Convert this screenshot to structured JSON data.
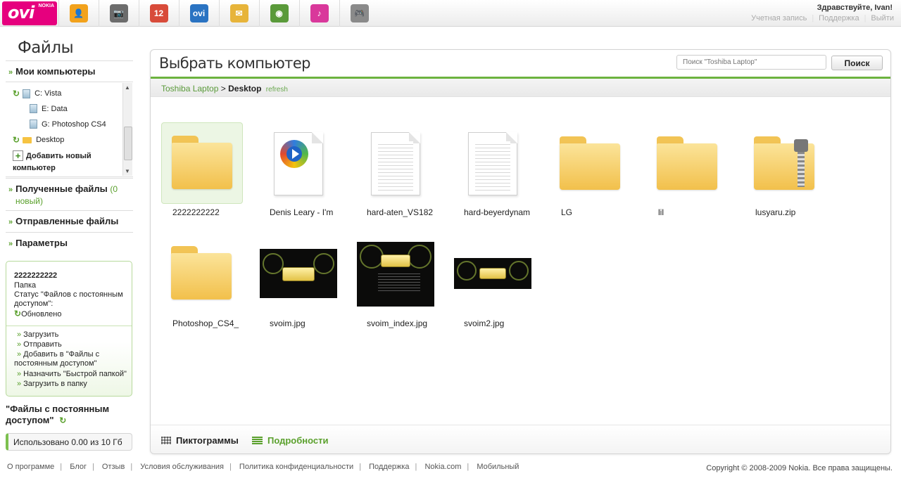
{
  "header": {
    "logo_text": "ovi",
    "logo_sub": "NOKIA",
    "apps": [
      {
        "name": "contacts-app-icon",
        "color": "#f2a21c",
        "glyph": "👤"
      },
      {
        "name": "photos-app-icon",
        "color": "#6c6c6c",
        "glyph": "📷"
      },
      {
        "name": "calendar-app-icon",
        "color": "#d84b3a",
        "glyph": "12"
      },
      {
        "name": "store-app-icon",
        "color": "#2a73c2",
        "glyph": "ovi"
      },
      {
        "name": "mail-app-icon",
        "color": "#e7b43a",
        "glyph": "✉"
      },
      {
        "name": "maps-app-icon",
        "color": "#5a9a3a",
        "glyph": "◉"
      },
      {
        "name": "music-app-icon",
        "color": "#d9389b",
        "glyph": "♪"
      },
      {
        "name": "games-app-icon",
        "color": "#8a8a8a",
        "glyph": "🎮"
      }
    ],
    "greeting": "Здравствуйте, Ivan!",
    "links": [
      "Учетная запись",
      "Поддержка",
      "Выйти"
    ]
  },
  "sidebar": {
    "title": "Файлы",
    "my_computers": "Мои компьютеры",
    "tree": [
      "C: Vista",
      "E: Data",
      "G: Photoshop CS4",
      "Desktop"
    ],
    "add_computer_1": "Добавить новый",
    "add_computer_2": "компьютер",
    "received": "Полученные файлы",
    "received_count": "(0",
    "received_count2": "новый)",
    "sent": "Отправленные файлы",
    "params": "Параметры",
    "info": {
      "name": "2222222222",
      "type": "Папка",
      "status_1": "Статус \"Файлов с постоянным",
      "status_2": "доступом\":",
      "status_value": "Обновлено",
      "actions": [
        "Загрузить",
        "Отправить",
        "Добавить в \"Файлы с",
        "постоянным доступом\"",
        "Назначить \"Быстрой папкой\"",
        "Загрузить в папку"
      ]
    },
    "shared_title_1": "\"Файлы с постоянным",
    "shared_title_2": "доступом\"",
    "usage": "Использовано 0.00 из 10 Гб"
  },
  "panel": {
    "title": "Выбрать компьютер",
    "search_placeholder": "Поиск \"Toshiba Laptop\"",
    "search_button": "Поиск",
    "crumb_root": "Toshiba Laptop",
    "crumb_sep": ">",
    "crumb_current": "Desktop",
    "refresh": "refresh",
    "files": [
      "2222222222",
      "Denis Leary - I'm",
      "hard-aten_VS182",
      "hard-beyerdynam",
      "LG",
      "lil",
      "lusyaru.zip",
      "Photoshop_CS4_",
      "svoim.jpg",
      "svoim_index.jpg",
      "svoim2.jpg"
    ],
    "view_icons": "Пиктограммы",
    "view_details": "Подробности"
  },
  "footer": {
    "links": [
      "О программе",
      "Блог",
      "Отзыв",
      "Условия обслуживания",
      "Политика конфиденциальности",
      "Поддержка",
      "Nokia.com",
      "Мобильный"
    ],
    "copyright": "Copyright © 2008-2009 Nokia. Все права защищены."
  }
}
